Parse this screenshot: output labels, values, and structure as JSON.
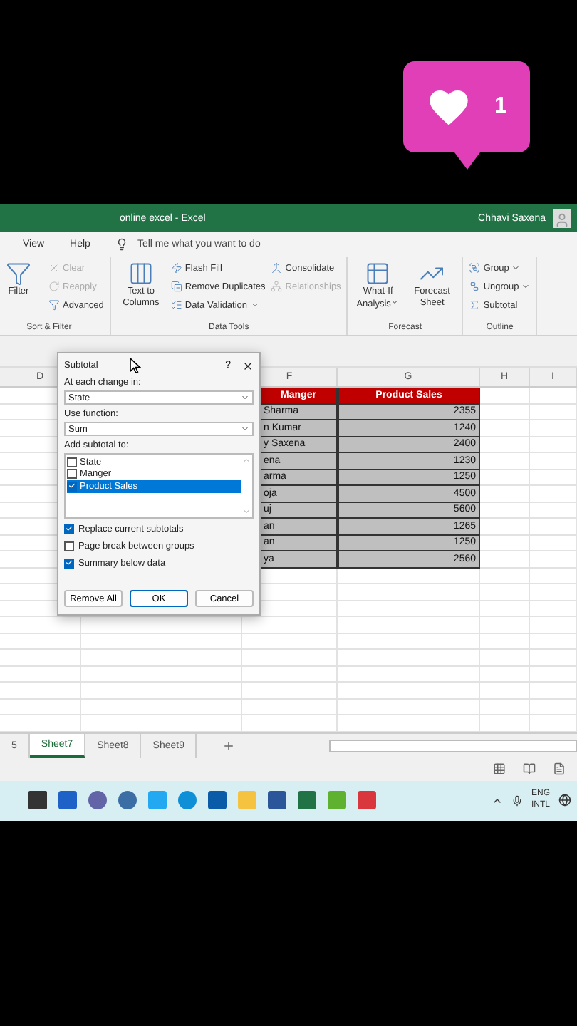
{
  "like_badge": {
    "count": "1"
  },
  "title_bar": {
    "title": "online excel  -  Excel",
    "user": "Chhavi Saxena"
  },
  "menu": [
    "View",
    "Help"
  ],
  "tell_me": {
    "placeholder": "Tell me what you want to do"
  },
  "ribbon_groups": [
    {
      "label": "Sort & Filter",
      "columns": [
        [
          {
            "kind": "large",
            "label": "Filter",
            "disabled": false,
            "dropdown": false
          }
        ],
        [
          {
            "kind": "small",
            "label": "Clear",
            "disabled": true,
            "dropdown": false
          },
          {
            "kind": "small",
            "label": "Reapply",
            "disabled": true,
            "dropdown": false
          },
          {
            "kind": "small",
            "label": "Advanced",
            "disabled": false,
            "dropdown": false
          }
        ]
      ]
    },
    {
      "label": "Data Tools",
      "columns": [
        [
          {
            "kind": "large",
            "label": "Text to Columns",
            "disabled": false,
            "dropdown": false
          }
        ],
        [
          {
            "kind": "small",
            "label": "Flash Fill",
            "disabled": false,
            "dropdown": false
          },
          {
            "kind": "small",
            "label": "Remove Duplicates",
            "disabled": false,
            "dropdown": false
          },
          {
            "kind": "small",
            "label": "Data Validation",
            "disabled": false,
            "dropdown": true
          }
        ],
        [
          {
            "kind": "small",
            "label": "Consolidate",
            "disabled": false,
            "dropdown": false
          },
          {
            "kind": "small",
            "label": "Relationships",
            "disabled": true,
            "dropdown": false
          }
        ]
      ]
    },
    {
      "label": "Forecast",
      "columns": [
        [
          {
            "kind": "large",
            "label": "What-If Analysis",
            "disabled": false,
            "dropdown": true
          }
        ],
        [
          {
            "kind": "large",
            "label": "Forecast Sheet",
            "disabled": false,
            "dropdown": false
          }
        ]
      ]
    },
    {
      "label": "Outline",
      "columns": [
        [
          {
            "kind": "small",
            "label": "Group",
            "disabled": false,
            "dropdown": true
          },
          {
            "kind": "small",
            "label": "Ungroup",
            "disabled": false,
            "dropdown": true
          },
          {
            "kind": "small",
            "label": "Subtotal",
            "disabled": false,
            "dropdown": false
          }
        ]
      ]
    }
  ],
  "grid": {
    "column_headers": [
      "D",
      "F",
      "G",
      "H",
      "I"
    ],
    "table_header": [
      "Manger",
      "Product Sales"
    ],
    "rows": [
      [
        "Sharma",
        "2355"
      ],
      [
        "n Kumar",
        "1240"
      ],
      [
        "y Saxena",
        "2400"
      ],
      [
        "ena",
        "1230"
      ],
      [
        "arma",
        "1250"
      ],
      [
        "oja",
        "4500"
      ],
      [
        "uj",
        "5600"
      ],
      [
        "an",
        "1265"
      ],
      [
        "an",
        "1250"
      ],
      [
        "ya",
        "2560"
      ]
    ]
  },
  "dialog": {
    "title": "Subtotal",
    "help": "?",
    "change_label": "At each change in:",
    "change_value": "State",
    "function_label": "Use function:",
    "function_value": "Sum",
    "add_label": "Add subtotal to:",
    "add_items": [
      {
        "label": "State",
        "checked": false,
        "selected": false
      },
      {
        "label": "Manger",
        "checked": false,
        "selected": false
      },
      {
        "label": "Product Sales",
        "checked": true,
        "selected": true
      }
    ],
    "options": [
      {
        "label": "Replace current subtotals",
        "checked": true
      },
      {
        "label": "Page break between groups",
        "checked": false
      },
      {
        "label": "Summary below data",
        "checked": true
      }
    ],
    "buttons": [
      {
        "label": "Remove All",
        "default": false
      },
      {
        "label": "OK",
        "default": true
      },
      {
        "label": "Cancel",
        "default": false
      }
    ]
  },
  "sheet_tabs": [
    {
      "label": "5",
      "selected": false
    },
    {
      "label": "Sheet7",
      "selected": true
    },
    {
      "label": "Sheet8",
      "selected": false
    },
    {
      "label": "Sheet9",
      "selected": false
    }
  ],
  "taskbar": {
    "language": "ENG",
    "layout": "INTL"
  }
}
